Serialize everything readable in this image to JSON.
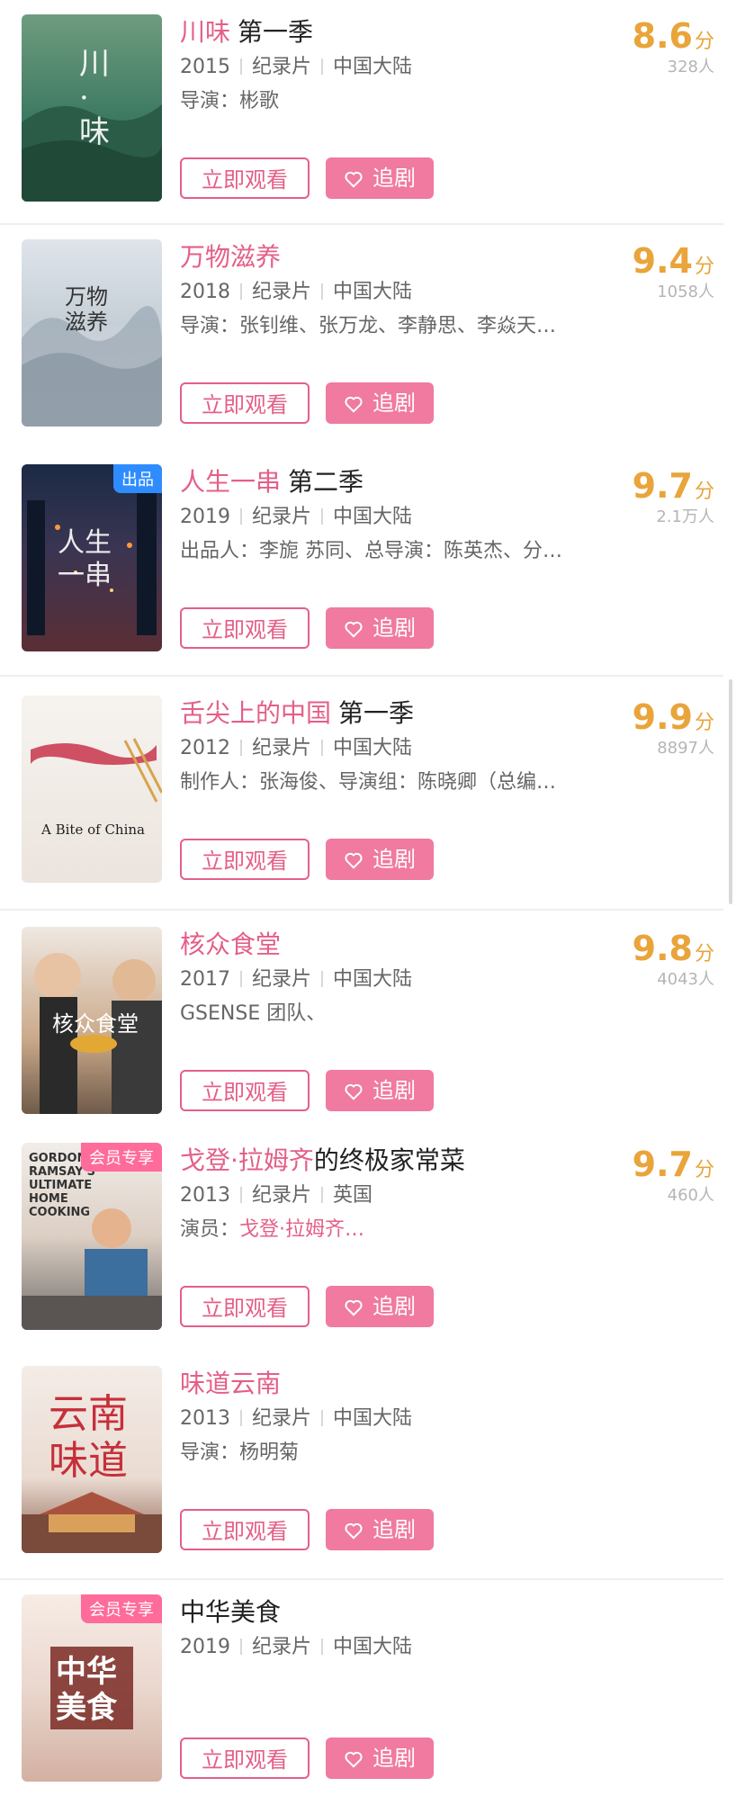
{
  "buttons": {
    "watch_label": "立即观看",
    "follow_label": "追剧"
  },
  "items": [
    {
      "title": "川味",
      "subtitle": "第一季",
      "year": "2015",
      "genre": "纪录片",
      "region": "中国大陆",
      "people_label": "导演：",
      "people": "彬歌",
      "score": "8.6",
      "unit": "分",
      "count": "328人",
      "poster_text": "川·味",
      "badge": ""
    },
    {
      "title": "万物滋养",
      "subtitle": "",
      "year": "2018",
      "genre": "纪录片",
      "region": "中国大陆",
      "people_label": "导演：",
      "people": "张钊维、张万龙、李静思、李焱天…",
      "score": "9.4",
      "unit": "分",
      "count": "1058人",
      "poster_text": "万物滋养",
      "badge": ""
    },
    {
      "title": "人生一串",
      "subtitle": "第二季",
      "year": "2019",
      "genre": "纪录片",
      "region": "中国大陆",
      "people_label": "出品人：",
      "people": "李旎 苏同、总导演：陈英杰、分…",
      "score": "9.7",
      "unit": "分",
      "count": "2.1万人",
      "poster_text": "人生一串",
      "badge": "出品"
    },
    {
      "title": "舌尖上的中国",
      "subtitle": "第一季",
      "year": "2012",
      "genre": "纪录片",
      "region": "中国大陆",
      "people_label": "制作人：",
      "people": "张海俊、导演组：陈晓卿（总编…",
      "score": "9.9",
      "unit": "分",
      "count": "8897人",
      "poster_text": "A Bite of China",
      "badge": ""
    },
    {
      "title": "核众食堂",
      "subtitle": "",
      "year": "2017",
      "genre": "纪录片",
      "region": "中国大陆",
      "people_label": "",
      "people": "GSENSE 团队、",
      "score": "9.8",
      "unit": "分",
      "count": "4043人",
      "poster_text": "核众食堂",
      "badge": ""
    },
    {
      "title": "戈登·拉姆齐",
      "subtitle": "的终极家常菜",
      "year": "2013",
      "genre": "纪录片",
      "region": "英国",
      "people_label": "演员：",
      "people": "戈登·拉姆齐…",
      "score": "9.7",
      "unit": "分",
      "count": "460人",
      "poster_text": "GORDON RAMSAY'S ULTIMATE HOME COOKING",
      "badge": "会员专享"
    },
    {
      "title": "味道云南",
      "subtitle": "",
      "year": "2013",
      "genre": "纪录片",
      "region": "中国大陆",
      "people_label": "导演：",
      "people": "杨明菊",
      "score": "",
      "unit": "",
      "count": "",
      "poster_text": "云南味道",
      "badge": ""
    },
    {
      "title": "",
      "subtitle": "中华美食",
      "year": "2019",
      "genre": "纪录片",
      "region": "中国大陆",
      "people_label": "",
      "people": "",
      "score": "",
      "unit": "",
      "count": "",
      "poster_text": "中华美食",
      "badge": "会员专享"
    }
  ],
  "colors": {
    "accent": "#e45f87",
    "score": "#e9a43a",
    "follow_bg": "#f07aa0"
  },
  "icons": {
    "follow": "heart-icon"
  }
}
